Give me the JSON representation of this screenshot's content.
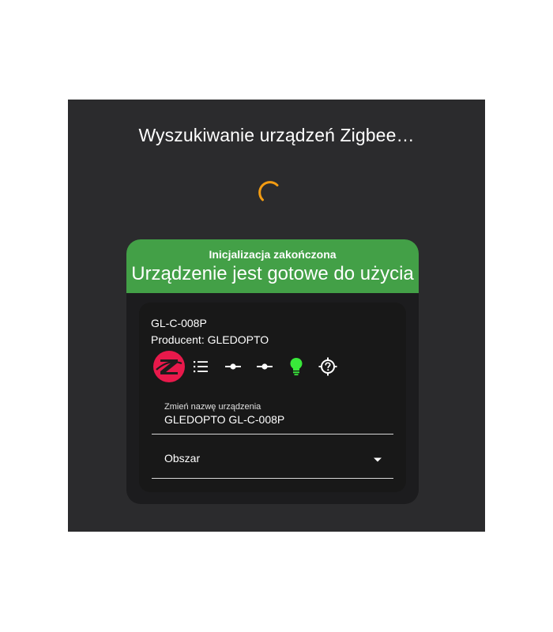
{
  "dialog": {
    "title": "Wyszukiwanie urządzeń Zigbee…",
    "spinner_color": "#f39c12"
  },
  "device_card": {
    "status_sub": "Inicjalizacja zakończona",
    "status_main": "Urządzenie jest gotowe do użycia",
    "header_color": "#43a047",
    "model": "GL-C-008P",
    "manufacturer": "Producent: GLEDOPTO",
    "icons": [
      "zigbee-logo-icon",
      "list-icon",
      "commit-icon",
      "commit-icon",
      "lightbulb-icon",
      "crosshair-help-icon"
    ],
    "bulb_color": "#39e83a",
    "zigbee_color": "#e8194b",
    "rename_field": {
      "label": "Zmień nazwę urządzenia",
      "value": "GLEDOPTO GL-C-008P"
    },
    "area_select": {
      "label": "Obszar"
    }
  }
}
